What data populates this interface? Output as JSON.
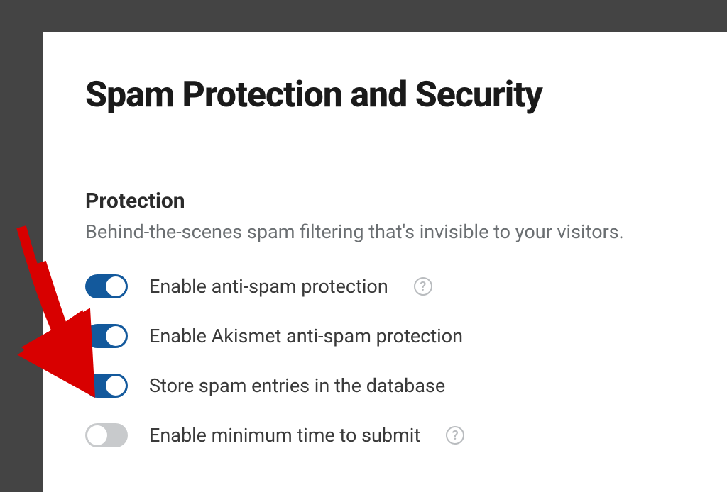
{
  "page": {
    "title": "Spam Protection and Security"
  },
  "section": {
    "heading": "Protection",
    "description": "Behind-the-scenes spam filtering that's invisible to your visitors."
  },
  "options": [
    {
      "id": "anti-spam",
      "label": "Enable anti-spam protection",
      "on": true,
      "help": true
    },
    {
      "id": "akismet",
      "label": "Enable Akismet anti-spam protection",
      "on": true,
      "help": false
    },
    {
      "id": "store-spam",
      "label": "Store spam entries in the database",
      "on": true,
      "help": false
    },
    {
      "id": "min-time-submit",
      "label": "Enable minimum time to submit",
      "on": false,
      "help": true
    }
  ],
  "annotation": {
    "arrow_target": "store-spam",
    "color": "#d80000"
  }
}
